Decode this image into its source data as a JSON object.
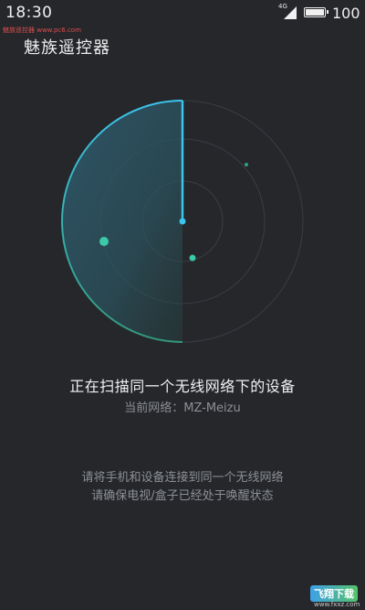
{
  "status_bar": {
    "time": "18:30",
    "network_type": "4G",
    "battery_level": "100"
  },
  "watermark_top": "魅族遥控器 www.pc6.com",
  "app": {
    "title": "魅族遥控器"
  },
  "radar": {
    "accent_color": "#3cc3ee",
    "device_dot_color": "#3cc9a8",
    "sweep_fraction": 0.5
  },
  "scan": {
    "title": "正在扫描同一个无线网络下的设备",
    "network_label": "当前网络：MZ-Meizu"
  },
  "hints": {
    "line1": "请将手机和设备连接到同一个无线网络",
    "line2": "请确保电视/盒子已经处于唤醒状态"
  },
  "watermark_badge": {
    "logo": "飞翔下载",
    "url": "www.fxxz.com"
  }
}
